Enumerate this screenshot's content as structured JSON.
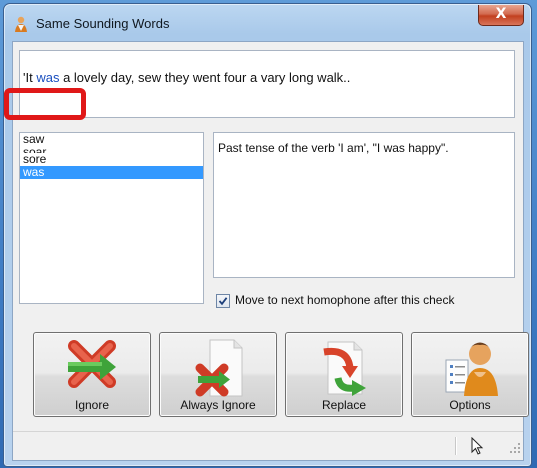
{
  "window": {
    "title": "Same Sounding Words",
    "close_glyph": "X"
  },
  "sentence": {
    "before": "'It ",
    "highlight": "was",
    "after": " a lovely day, sew they went four a vary long walk.."
  },
  "word_list": {
    "items": [
      {
        "label": "saw",
        "selected": false
      },
      {
        "label": "soar",
        "selected": false
      },
      {
        "label": "sore",
        "selected": false
      },
      {
        "label": "was",
        "selected": true
      }
    ]
  },
  "definition": "Past tense of the verb 'I am', \"I was happy\".",
  "option": {
    "label": "Move to next homophone after this check",
    "checked": true
  },
  "buttons": {
    "ignore": "Ignore",
    "always_ignore": "Always Ignore",
    "replace": "Replace",
    "options": "Options"
  },
  "colors": {
    "highlight_word": "#1a4fbf",
    "selection": "#3399ff",
    "annotation_frame": "#e01818"
  },
  "icons": [
    "app-icon",
    "ignore-icon",
    "always-ignore-icon",
    "replace-icon",
    "options-icon",
    "cursor-icon",
    "size-grip-icon"
  ]
}
